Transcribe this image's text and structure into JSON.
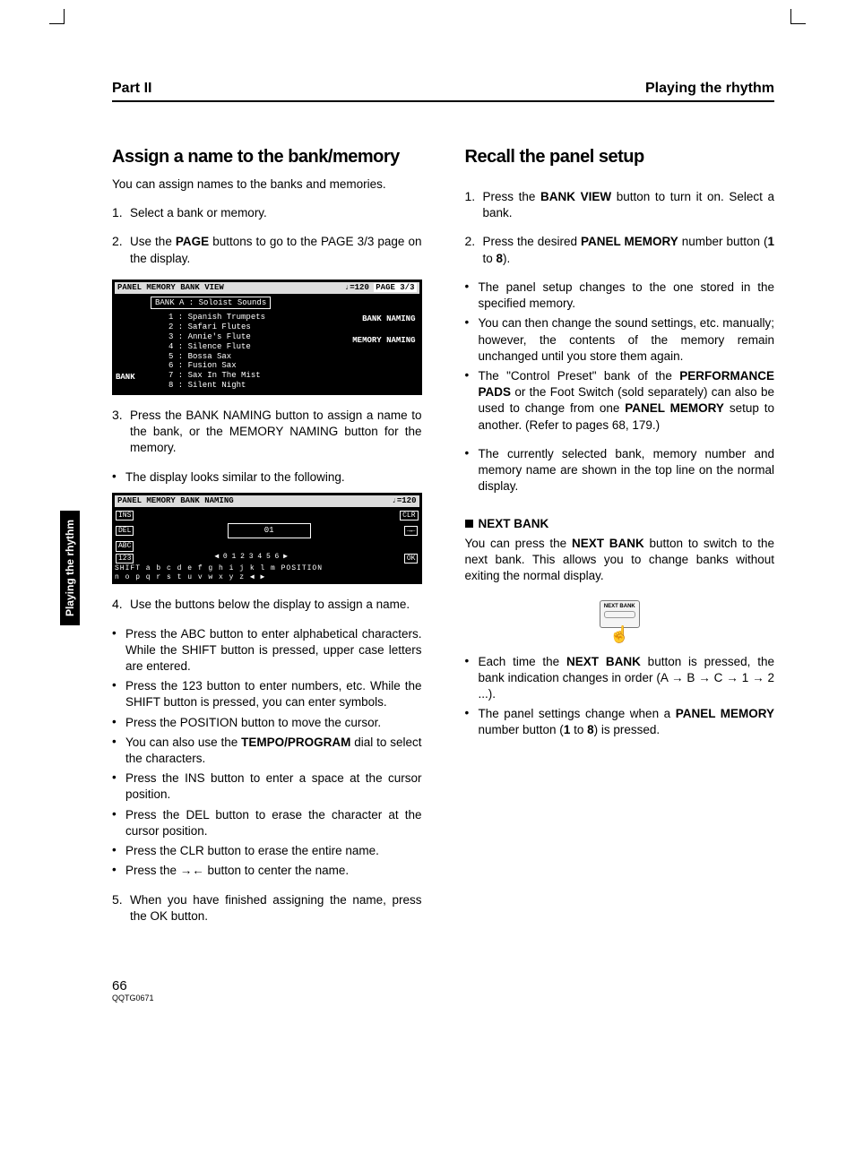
{
  "header": {
    "left": "Part II",
    "right": "Playing the rhythm"
  },
  "sideTab": "Playing the rhythm",
  "left": {
    "title": "Assign a name to the bank/memory",
    "intro": "You can assign names to the banks and memories.",
    "step1": "Select a bank or memory.",
    "step2": {
      "pre": "Use the ",
      "b": "PAGE",
      "post": " buttons to go to the PAGE 3/3 page on the display."
    },
    "screen1": {
      "title": "PANEL MEMORY BANK VIEW",
      "tempo": "♩=120",
      "page": "PAGE 3/3",
      "bank": "BANK A :  Soloist Sounds",
      "items": [
        "1 :  Spanish Trumpets",
        "2 :   Safari Flutes",
        "3 :   Annie's Flute",
        "4 :   Silence Flute",
        "5 :     Bossa Sax",
        "6 :    Fusion Sax",
        "7 :  Sax In The Mist",
        "8 :    Silent Night"
      ],
      "rbtn1": "BANK NAMING",
      "rbtn2": "MEMORY NAMING",
      "lbtn": "BANK"
    },
    "step3a": "Press the BANK NAMING button to assign a name to the bank, or the MEMORY NAMING button for the memory.",
    "step3b": "The display looks similar to the following.",
    "screen2": {
      "title": "PANEL MEMORY BANK NAMING",
      "tempo": "♩=120",
      "left": [
        "INS",
        "DEL",
        "ABC",
        "123"
      ],
      "right": [
        "CLR",
        "→←",
        "OK"
      ],
      "field": "01",
      "numrow": "◀ 0 1 2 3 4 5 6 ▶",
      "bottom": "SHIFT  a b c d e f g h i j k l m  POSITION",
      "bottom2": "       n o p q r s t u v w x y z  ◀ ▶"
    },
    "step4": "Use the buttons below the display to assign a name.",
    "s4b1": "Press the ABC button to enter alphabetical characters. While the SHIFT button is pressed, upper case letters are entered.",
    "s4b2": "Press the 123 button to enter numbers, etc. While the SHIFT button is pressed, you can enter symbols.",
    "s4b3": "Press the POSITION button to move the cursor.",
    "s4b4": {
      "pre": "You can also use the ",
      "b": "TEMPO/PROGRAM",
      "post": " dial to select the characters."
    },
    "s4b5": "Press the INS button to enter a space at the cursor position.",
    "s4b6": "Press the DEL button to erase the character at the cursor position.",
    "s4b7": "Press the CLR button to erase the entire name.",
    "s4b8": "Press the →← button to center the name.",
    "step5": "When you have finished assigning the name, press the OK button."
  },
  "right": {
    "title": "Recall the panel setup",
    "r1": {
      "pre": "Press the ",
      "b": "BANK VIEW",
      "post": " button to turn it on. Select a bank."
    },
    "r2": {
      "pre": "Press the desired ",
      "b1": "PANEL MEMORY",
      "mid": " number button (",
      "b2": "1",
      "mid2": " to ",
      "b3": "8",
      "post": ")."
    },
    "r2a": "The panel setup changes to the one stored in the specified memory.",
    "r2b": "You can then change the sound settings, etc. manually; however, the contents of the memory remain unchanged until you store them again.",
    "r2c": {
      "pre": "The \"Control Preset\" bank of the ",
      "b1": "PERFORMANCE PADS",
      "mid": " or the Foot Switch (sold separately) can also be used to change from one ",
      "b2": "PANEL MEMORY",
      "post": " setup to another. (Refer to pages 68, 179.)"
    },
    "r2d": "The currently selected bank, memory number and memory name are shown in the top line on the normal display.",
    "nextHeading": "NEXT BANK",
    "nextP": {
      "pre": "You can press the ",
      "b": "NEXT BANK",
      "post": " button to switch to the next bank. This allows you to change banks without exiting the normal display."
    },
    "nextBtnLabel": "NEXT BANK",
    "nb1": {
      "pre": "Each time the ",
      "b": "NEXT BANK",
      "post": " button is pressed, the bank indication changes in order (A → B → C → 1 → 2 ...)."
    },
    "nb2": {
      "pre": "The panel settings change when a ",
      "b1": "PANEL MEMORY",
      "mid": " number button (",
      "b2": "1",
      "mid2": " to ",
      "b3": "8",
      "post": ") is pressed."
    }
  },
  "footer": {
    "pageNum": "66",
    "docId": "QQTG0671"
  }
}
